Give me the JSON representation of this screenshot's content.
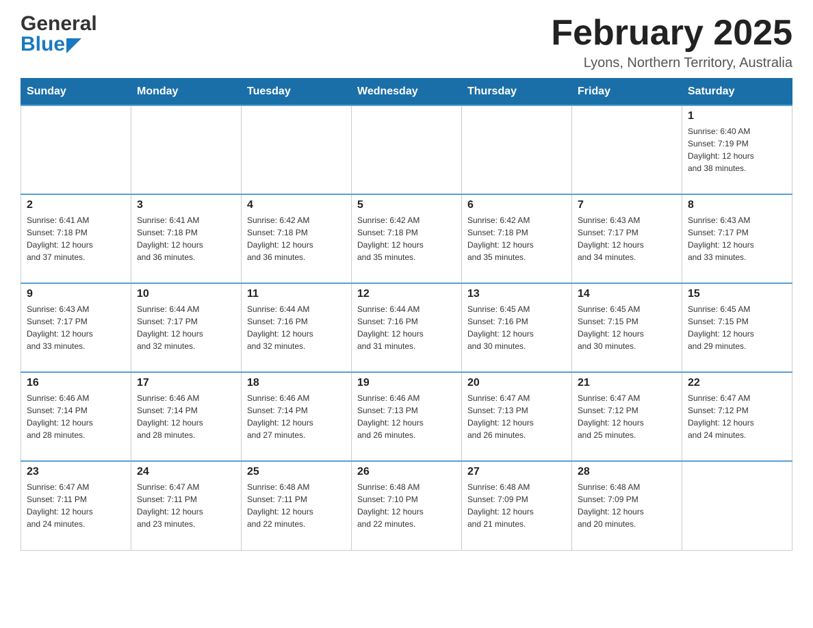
{
  "header": {
    "logo_general": "General",
    "logo_blue": "Blue",
    "month_title": "February 2025",
    "location": "Lyons, Northern Territory, Australia"
  },
  "weekdays": [
    "Sunday",
    "Monday",
    "Tuesday",
    "Wednesday",
    "Thursday",
    "Friday",
    "Saturday"
  ],
  "weeks": [
    [
      {
        "day": "",
        "info": ""
      },
      {
        "day": "",
        "info": ""
      },
      {
        "day": "",
        "info": ""
      },
      {
        "day": "",
        "info": ""
      },
      {
        "day": "",
        "info": ""
      },
      {
        "day": "",
        "info": ""
      },
      {
        "day": "1",
        "info": "Sunrise: 6:40 AM\nSunset: 7:19 PM\nDaylight: 12 hours\nand 38 minutes."
      }
    ],
    [
      {
        "day": "2",
        "info": "Sunrise: 6:41 AM\nSunset: 7:18 PM\nDaylight: 12 hours\nand 37 minutes."
      },
      {
        "day": "3",
        "info": "Sunrise: 6:41 AM\nSunset: 7:18 PM\nDaylight: 12 hours\nand 36 minutes."
      },
      {
        "day": "4",
        "info": "Sunrise: 6:42 AM\nSunset: 7:18 PM\nDaylight: 12 hours\nand 36 minutes."
      },
      {
        "day": "5",
        "info": "Sunrise: 6:42 AM\nSunset: 7:18 PM\nDaylight: 12 hours\nand 35 minutes."
      },
      {
        "day": "6",
        "info": "Sunrise: 6:42 AM\nSunset: 7:18 PM\nDaylight: 12 hours\nand 35 minutes."
      },
      {
        "day": "7",
        "info": "Sunrise: 6:43 AM\nSunset: 7:17 PM\nDaylight: 12 hours\nand 34 minutes."
      },
      {
        "day": "8",
        "info": "Sunrise: 6:43 AM\nSunset: 7:17 PM\nDaylight: 12 hours\nand 33 minutes."
      }
    ],
    [
      {
        "day": "9",
        "info": "Sunrise: 6:43 AM\nSunset: 7:17 PM\nDaylight: 12 hours\nand 33 minutes."
      },
      {
        "day": "10",
        "info": "Sunrise: 6:44 AM\nSunset: 7:17 PM\nDaylight: 12 hours\nand 32 minutes."
      },
      {
        "day": "11",
        "info": "Sunrise: 6:44 AM\nSunset: 7:16 PM\nDaylight: 12 hours\nand 32 minutes."
      },
      {
        "day": "12",
        "info": "Sunrise: 6:44 AM\nSunset: 7:16 PM\nDaylight: 12 hours\nand 31 minutes."
      },
      {
        "day": "13",
        "info": "Sunrise: 6:45 AM\nSunset: 7:16 PM\nDaylight: 12 hours\nand 30 minutes."
      },
      {
        "day": "14",
        "info": "Sunrise: 6:45 AM\nSunset: 7:15 PM\nDaylight: 12 hours\nand 30 minutes."
      },
      {
        "day": "15",
        "info": "Sunrise: 6:45 AM\nSunset: 7:15 PM\nDaylight: 12 hours\nand 29 minutes."
      }
    ],
    [
      {
        "day": "16",
        "info": "Sunrise: 6:46 AM\nSunset: 7:14 PM\nDaylight: 12 hours\nand 28 minutes."
      },
      {
        "day": "17",
        "info": "Sunrise: 6:46 AM\nSunset: 7:14 PM\nDaylight: 12 hours\nand 28 minutes."
      },
      {
        "day": "18",
        "info": "Sunrise: 6:46 AM\nSunset: 7:14 PM\nDaylight: 12 hours\nand 27 minutes."
      },
      {
        "day": "19",
        "info": "Sunrise: 6:46 AM\nSunset: 7:13 PM\nDaylight: 12 hours\nand 26 minutes."
      },
      {
        "day": "20",
        "info": "Sunrise: 6:47 AM\nSunset: 7:13 PM\nDaylight: 12 hours\nand 26 minutes."
      },
      {
        "day": "21",
        "info": "Sunrise: 6:47 AM\nSunset: 7:12 PM\nDaylight: 12 hours\nand 25 minutes."
      },
      {
        "day": "22",
        "info": "Sunrise: 6:47 AM\nSunset: 7:12 PM\nDaylight: 12 hours\nand 24 minutes."
      }
    ],
    [
      {
        "day": "23",
        "info": "Sunrise: 6:47 AM\nSunset: 7:11 PM\nDaylight: 12 hours\nand 24 minutes."
      },
      {
        "day": "24",
        "info": "Sunrise: 6:47 AM\nSunset: 7:11 PM\nDaylight: 12 hours\nand 23 minutes."
      },
      {
        "day": "25",
        "info": "Sunrise: 6:48 AM\nSunset: 7:11 PM\nDaylight: 12 hours\nand 22 minutes."
      },
      {
        "day": "26",
        "info": "Sunrise: 6:48 AM\nSunset: 7:10 PM\nDaylight: 12 hours\nand 22 minutes."
      },
      {
        "day": "27",
        "info": "Sunrise: 6:48 AM\nSunset: 7:09 PM\nDaylight: 12 hours\nand 21 minutes."
      },
      {
        "day": "28",
        "info": "Sunrise: 6:48 AM\nSunset: 7:09 PM\nDaylight: 12 hours\nand 20 minutes."
      },
      {
        "day": "",
        "info": ""
      }
    ]
  ]
}
